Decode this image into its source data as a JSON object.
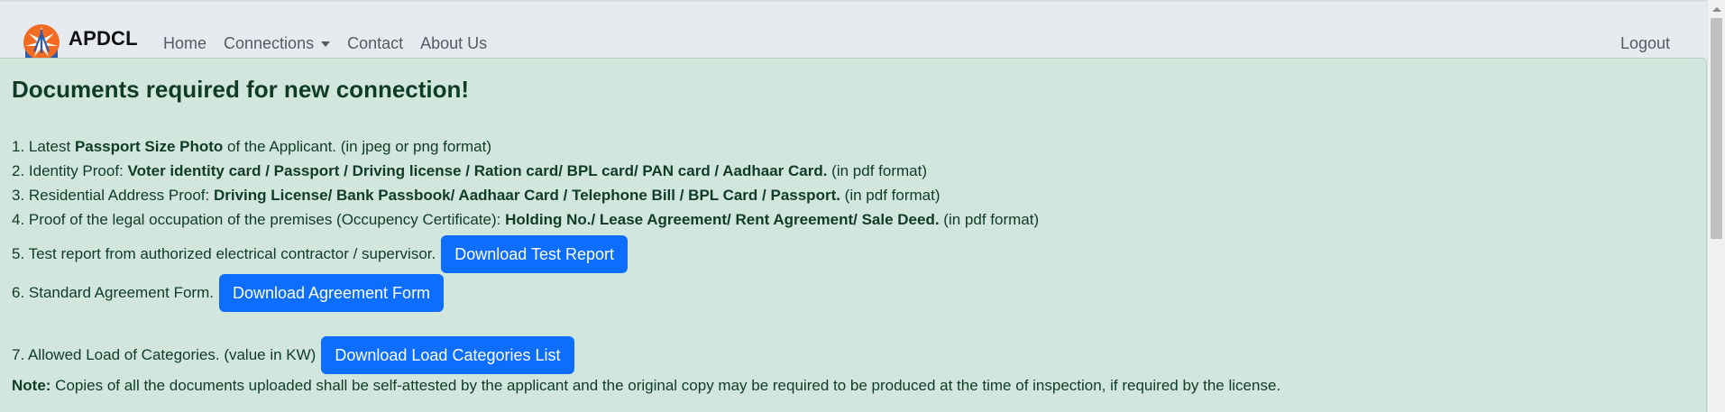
{
  "brand": {
    "name": "APDCL"
  },
  "nav": {
    "home": "Home",
    "connections": "Connections",
    "contact": "Contact",
    "about": "About Us",
    "logout": "Logout"
  },
  "page": {
    "title": "Documents required for new connection!",
    "item1": {
      "pre": "1. Latest ",
      "bold": "Passport Size Photo",
      "post": " of the Applicant. (in jpeg or png format)"
    },
    "item2": {
      "pre": "2. Identity Proof: ",
      "bold": "Voter identity card / Passport / Driving license / Ration card/ BPL card/ PAN card / Aadhaar Card.",
      "post": " (in pdf format)"
    },
    "item3": {
      "pre": "3. Residential Address Proof: ",
      "bold": "Driving License/ Bank Passbook/ Aadhaar Card / Telephone Bill / BPL Card / Passport.",
      "post": " (in pdf format)"
    },
    "item4": {
      "pre": "4. Proof of the legal occupation of the premises (Occupency Certificate): ",
      "bold": "Holding No./ Lease Agreement/ Rent Agreement/ Sale Deed.",
      "post": " (in pdf format)"
    },
    "item5": {
      "text": "5. Test report from authorized electrical contractor / supervisor.",
      "button": "Download Test Report"
    },
    "item6": {
      "text": "6. Standard Agreement Form.",
      "button": "Download Agreement Form"
    },
    "item7": {
      "text": "7. Allowed Load of Categories. (value in KW)",
      "button": "Download Load Categories List"
    },
    "note": {
      "label": "Note:",
      "text": " Copies of all the documents uploaded shall be self-attested by the applicant and the original copy may be required to be produced at the time of inspection, if required by the license."
    }
  },
  "colors": {
    "panel_bg": "#d1e7dd",
    "panel_text": "#0f3b27",
    "button_bg": "#0d6efd",
    "navbar_bg": "#e6ebef"
  }
}
